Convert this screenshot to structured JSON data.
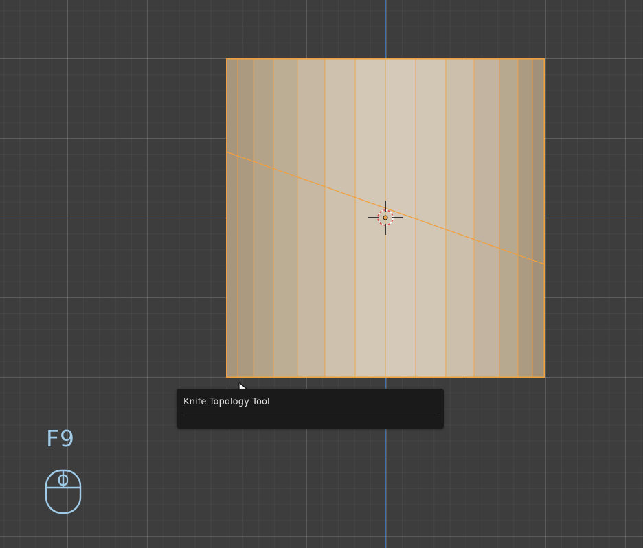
{
  "viewport": {
    "background": "#3d3d3d",
    "x_axis_color": "#a04a4a",
    "y_axis_color": "#3f6fa8"
  },
  "mesh": {
    "selection_color": "#f0a040",
    "face_colors": [
      "#a8967c",
      "#ab9a80",
      "#b3a389",
      "#bcad95",
      "#c6b8a3",
      "#cec2af",
      "#d3c7b5",
      "#d5cab9",
      "#d2c7b5",
      "#ccc0ad",
      "#c2b4a0",
      "#b7a890",
      "#ab9b82",
      "#a2907a",
      "#9c8870"
    ]
  },
  "tooltip": {
    "title": "Knife Topology Tool"
  },
  "keystroke_overlay": {
    "key": "F9",
    "icon": "mouse-icon",
    "color": "#9fcbe8"
  }
}
